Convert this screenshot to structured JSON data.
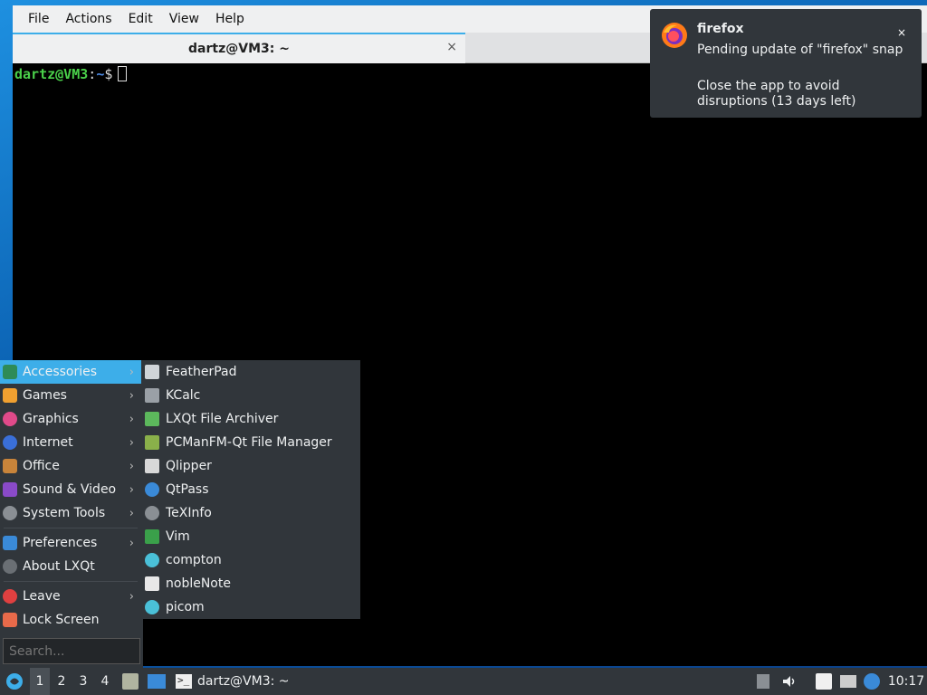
{
  "terminal": {
    "menu": [
      "File",
      "Actions",
      "Edit",
      "View",
      "Help"
    ],
    "tab_title": "dartz@VM3: ~",
    "tab_close": "×",
    "prompt_user": "dartz@VM3",
    "prompt_sep": ":",
    "prompt_path": "~",
    "prompt_dollar": "$"
  },
  "notification": {
    "app": "firefox",
    "line1": "Pending update of \"firefox\" snap",
    "line2": "Close the app to avoid disruptions (13 days left)",
    "close": "×"
  },
  "startmenu": {
    "categories": [
      {
        "label": "Accessories",
        "icon": "accessories-icon",
        "color": "#2e8b57",
        "submenu": true,
        "active": true
      },
      {
        "label": "Games",
        "icon": "games-icon",
        "color": "#f0a030",
        "submenu": true
      },
      {
        "label": "Graphics",
        "icon": "graphics-icon",
        "color": "#e04a8a",
        "submenu": true
      },
      {
        "label": "Internet",
        "icon": "internet-icon",
        "color": "#3a6fd8",
        "submenu": true
      },
      {
        "label": "Office",
        "icon": "office-icon",
        "color": "#c8843a",
        "submenu": true
      },
      {
        "label": "Sound & Video",
        "icon": "sound-video-icon",
        "color": "#8a4ac8",
        "submenu": true
      },
      {
        "label": "System Tools",
        "icon": "system-tools-icon",
        "color": "#8a8f94",
        "submenu": true
      },
      {
        "label": "Preferences",
        "icon": "preferences-icon",
        "color": "#3a8ad8",
        "submenu": true
      },
      {
        "label": "About LXQt",
        "icon": "about-icon",
        "color": "#6a6f74",
        "submenu": false
      },
      {
        "label": "Leave",
        "icon": "leave-icon",
        "color": "#e04040",
        "submenu": true
      },
      {
        "label": "Lock Screen",
        "icon": "lock-icon",
        "color": "#e86a4a",
        "submenu": false
      }
    ],
    "arrow": "›",
    "search_placeholder": "Search..."
  },
  "submenu": {
    "items": [
      {
        "label": "FeatherPad",
        "icon": "featherpad-icon",
        "color": "#d0d4d8"
      },
      {
        "label": "KCalc",
        "icon": "kcalc-icon",
        "color": "#9aa0a6"
      },
      {
        "label": "LXQt File Archiver",
        "icon": "archiver-icon",
        "color": "#5cb85c"
      },
      {
        "label": "PCManFM-Qt File Manager",
        "icon": "file-manager-icon",
        "color": "#8ab04a"
      },
      {
        "label": "Qlipper",
        "icon": "qlipper-icon",
        "color": "#d8d8d8"
      },
      {
        "label": "QtPass",
        "icon": "qtpass-icon",
        "color": "#3a8ad8"
      },
      {
        "label": "TeXInfo",
        "icon": "texinfo-icon",
        "color": "#8a8f94"
      },
      {
        "label": "Vim",
        "icon": "vim-icon",
        "color": "#3aa04a"
      },
      {
        "label": "compton",
        "icon": "compton-icon",
        "color": "#4ac0d8"
      },
      {
        "label": "nobleNote",
        "icon": "noblenote-icon",
        "color": "#e8e8e8"
      },
      {
        "label": "picom",
        "icon": "picom-icon",
        "color": "#4ac0d8"
      }
    ]
  },
  "taskbar": {
    "desktops": [
      "1",
      "2",
      "3",
      "4"
    ],
    "current_desktop": "1",
    "task_label": "dartz@VM3: ~",
    "clock": "10:17"
  },
  "colors": {
    "accent": "#3daee9",
    "panel_bg": "#31363b",
    "prompt_green": "#4ad04a",
    "prompt_blue": "#4d8be6"
  }
}
